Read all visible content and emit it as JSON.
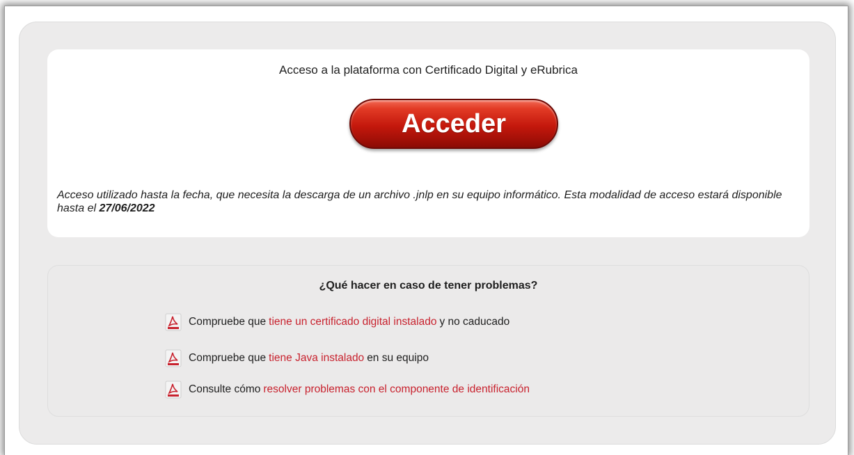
{
  "access": {
    "title": "Acceso a la plataforma con Certificado Digital y eRubrica",
    "button_label": "Acceder",
    "desc_text": "Acceso utilizado hasta la fecha, que necesita la descarga de un archivo .jnlp en su equipo informático. Esta modalidad de acceso estará disponible hasta el ",
    "desc_date": "27/06/2022"
  },
  "help": {
    "title": "¿Qué hacer en caso de tener problemas?",
    "items": [
      {
        "prefix": "Compruebe que",
        "link": "tiene un certificado digital instalado",
        "suffix": "y no caducado",
        "icon": "pdf-icon"
      },
      {
        "prefix": "Compruebe que",
        "link": "tiene Java instalado",
        "suffix": "en su equipo",
        "icon": "pdf-icon"
      },
      {
        "prefix": "Consulte cómo",
        "link": "resolver problemas con el componente de identificación",
        "suffix": "",
        "icon": "pdf-icon"
      }
    ]
  },
  "colors": {
    "button_red": "#c4180c",
    "link_red": "#c8222e",
    "panel_gray": "#ecebeb"
  }
}
